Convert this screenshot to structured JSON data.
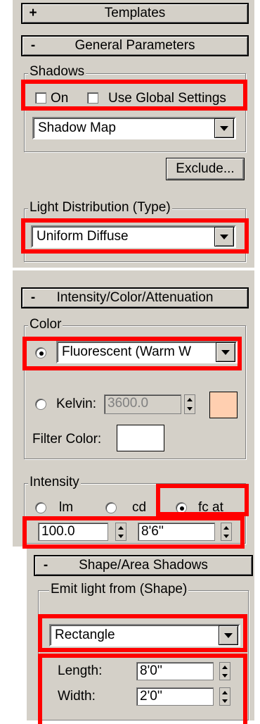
{
  "rollouts": {
    "templates": {
      "sign": "+",
      "title": "Templates"
    },
    "general": {
      "sign": "-",
      "title": "General Parameters"
    },
    "intensity": {
      "sign": "-",
      "title": "Intensity/Color/Attenuation"
    },
    "shape": {
      "sign": "-",
      "title": "Shape/Area Shadows"
    }
  },
  "shadows": {
    "group_label": "Shadows",
    "on_label": "On",
    "use_global_label": "Use Global Settings",
    "type_value": "Shadow Map",
    "exclude_label": "Exclude..."
  },
  "distribution": {
    "group_label": "Light Distribution (Type)",
    "value": "Uniform Diffuse"
  },
  "color": {
    "group_label": "Color",
    "preset_value": "Fluorescent (Warm W",
    "kelvin_label": "Kelvin:",
    "kelvin_value": "3600.0",
    "kelvin_swatch": "#ffcfb0",
    "filter_label": "Filter Color:",
    "filter_swatch": "#ffffff"
  },
  "intensity": {
    "group_label": "Intensity",
    "lm_label": "lm",
    "cd_label": "cd",
    "fc_label": "fc at",
    "value": "100.0",
    "distance": "8'6''"
  },
  "shape": {
    "group_label": "Emit light from (Shape)",
    "value": "Rectangle",
    "length_label": "Length:",
    "length_value": "8'0''",
    "width_label": "Width:",
    "width_value": "2'0''"
  },
  "highlight_color": "#ff0000"
}
